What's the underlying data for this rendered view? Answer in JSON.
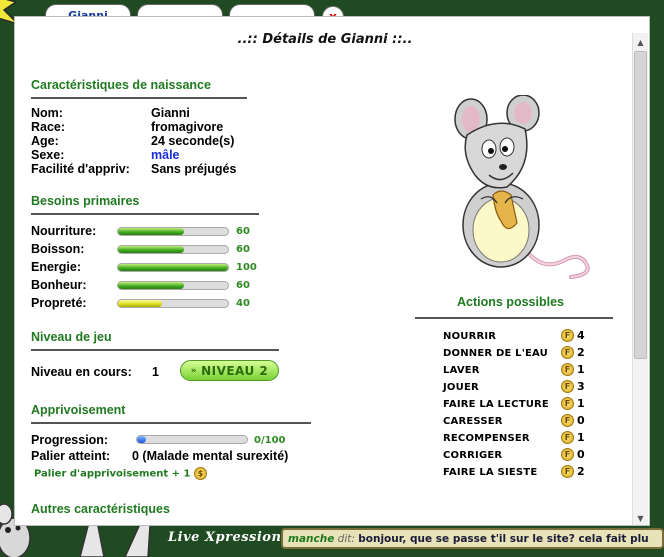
{
  "tabs": [
    {
      "label": "Gianni"
    },
    {
      "label": ""
    },
    {
      "label": ""
    }
  ],
  "close_label": "x",
  "panel_title": "..:: Détails de Gianni ::..",
  "birth": {
    "title": "Caractéristiques de naissance",
    "rows": [
      {
        "label": "Nom:",
        "value": "Gianni"
      },
      {
        "label": "Race:",
        "value": "fromagivore"
      },
      {
        "label": "Age:",
        "value": "24 seconde(s)"
      },
      {
        "label": "Sexe:",
        "value": "mâle"
      },
      {
        "label": "Facilité d'appriv:",
        "value": "Sans préjugés"
      }
    ]
  },
  "needs": {
    "title": "Besoins primaires",
    "rows": [
      {
        "label": "Nourriture:",
        "value": 60,
        "value_text": "60",
        "color": "green"
      },
      {
        "label": "Boisson:",
        "value": 60,
        "value_text": "60",
        "color": "green"
      },
      {
        "label": "Energie:",
        "value": 100,
        "value_text": "100",
        "color": "green"
      },
      {
        "label": "Bonheur:",
        "value": 60,
        "value_text": "60",
        "color": "green"
      },
      {
        "label": "Propreté:",
        "value": 40,
        "value_text": "40",
        "color": "yellow"
      }
    ]
  },
  "level": {
    "title": "Niveau de jeu",
    "label": "Niveau en cours:",
    "value": "1",
    "button_label": "NIVEAU 2",
    "button_icon": "chevrons-right-icon"
  },
  "tame": {
    "title": "Apprivoisement",
    "progress_label": "Progression:",
    "progress_value": 0,
    "progress_text": "0/100",
    "palier_label": "Palier atteint:",
    "palier_value": "0 (Malade mental surexité)",
    "palier_note": "Palier d'apprivoisement + 1"
  },
  "other": {
    "title": "Autres caractéristiques"
  },
  "actions": {
    "title": "Actions possibles",
    "coin_glyph": "F",
    "items": [
      {
        "label": "NOURRIR",
        "cost": "4"
      },
      {
        "label": "DONNER DE L'EAU",
        "cost": "2"
      },
      {
        "label": "LAVER",
        "cost": "1"
      },
      {
        "label": "JOUER",
        "cost": "3"
      },
      {
        "label": "FAIRE LA LECTURE",
        "cost": "1"
      },
      {
        "label": "CARESSER",
        "cost": "0"
      },
      {
        "label": "RECOMPENSER",
        "cost": "1"
      },
      {
        "label": "CORRIGER",
        "cost": "0"
      },
      {
        "label": "FAIRE LA SIESTE",
        "cost": "2"
      }
    ]
  },
  "live": {
    "logo": "Live Xpression:",
    "user": "manche",
    "dit": " dit: ",
    "message": "bonjour, que se passe t'il sur le site? cela fait plu"
  },
  "colors": {
    "section_green": "#217a21",
    "background": "#1f4a22",
    "tab_text": "#123a96"
  }
}
